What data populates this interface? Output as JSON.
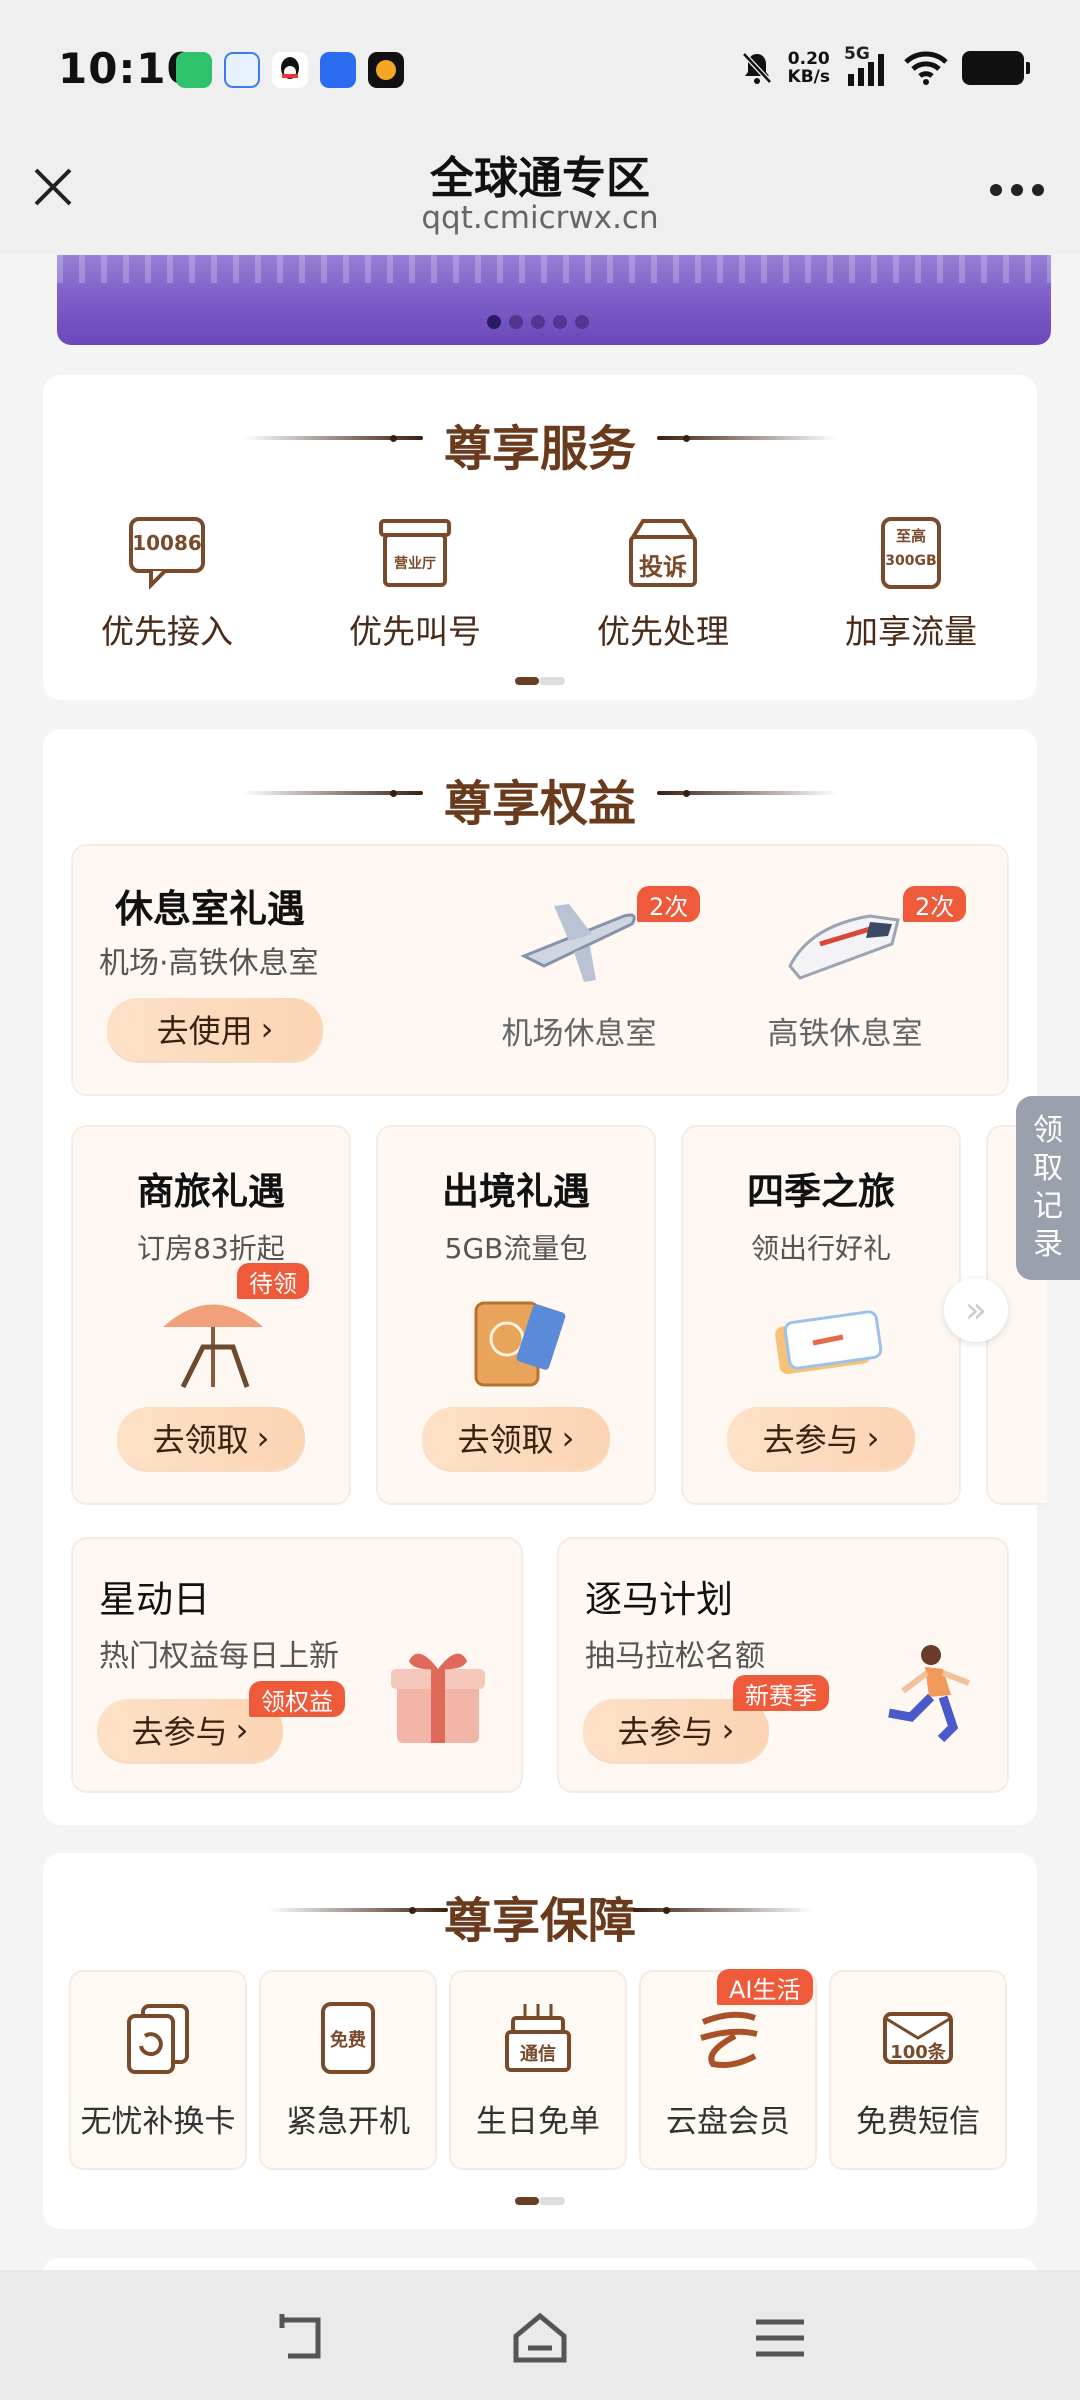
{
  "status_bar": {
    "time": "10:10",
    "speed_value": "0.20",
    "speed_unit": "KB/s",
    "network": "5G",
    "apps": [
      "wechat-icon",
      "chat-icon",
      "qq-icon",
      "zhijia-icon",
      "video-icon"
    ]
  },
  "header": {
    "title": "全球通专区",
    "url": "qqt.cmicrwx.cn"
  },
  "banner": {
    "slides": 5,
    "active": 1
  },
  "services": {
    "title": "尊享服务",
    "items": [
      {
        "label": "优先接入",
        "icon_text": "10086"
      },
      {
        "label": "优先叫号",
        "icon_text": "营业厅"
      },
      {
        "label": "优先处理",
        "icon_text": "投诉"
      },
      {
        "label": "加享流量",
        "icon_text_1": "至高",
        "icon_text_2": "300GB"
      }
    ]
  },
  "benefits": {
    "title": "尊享权益",
    "lounge": {
      "title": "休息室礼遇",
      "subtitle": "机场·高铁休息室",
      "button": "去使用",
      "items": [
        {
          "label": "机场休息室",
          "badge": "2次"
        },
        {
          "label": "高铁休息室",
          "badge": "2次"
        }
      ]
    },
    "tiles": [
      {
        "title": "商旅礼遇",
        "subtitle": "订房83折起",
        "badge": "待领",
        "button": "去领取"
      },
      {
        "title": "出境礼遇",
        "subtitle": "5GB流量包",
        "button": "去领取"
      },
      {
        "title": "四季之旅",
        "subtitle": "领出行好礼",
        "button": "去参与"
      }
    ],
    "big_tiles": [
      {
        "title": "星动日",
        "subtitle": "热门权益每日上新",
        "button": "去参与",
        "badge": "领权益"
      },
      {
        "title": "逐马计划",
        "subtitle": "抽马拉松名额",
        "button": "去参与",
        "badge": "新赛季"
      }
    ]
  },
  "guarantees": {
    "title": "尊享保障",
    "items": [
      {
        "label": "无忧补换卡"
      },
      {
        "label": "紧急开机",
        "icon_text": "免费"
      },
      {
        "label": "生日免单",
        "icon_text": "通信"
      },
      {
        "label": "云盘会员",
        "badge": "AI生活"
      },
      {
        "label": "免费短信",
        "icon_text": "100条"
      }
    ]
  },
  "side_tab": {
    "label": "领取记录"
  },
  "colors": {
    "brown": "#6a3a1c",
    "badge": "#ef5a3a",
    "pill": "#fcdcc0"
  }
}
